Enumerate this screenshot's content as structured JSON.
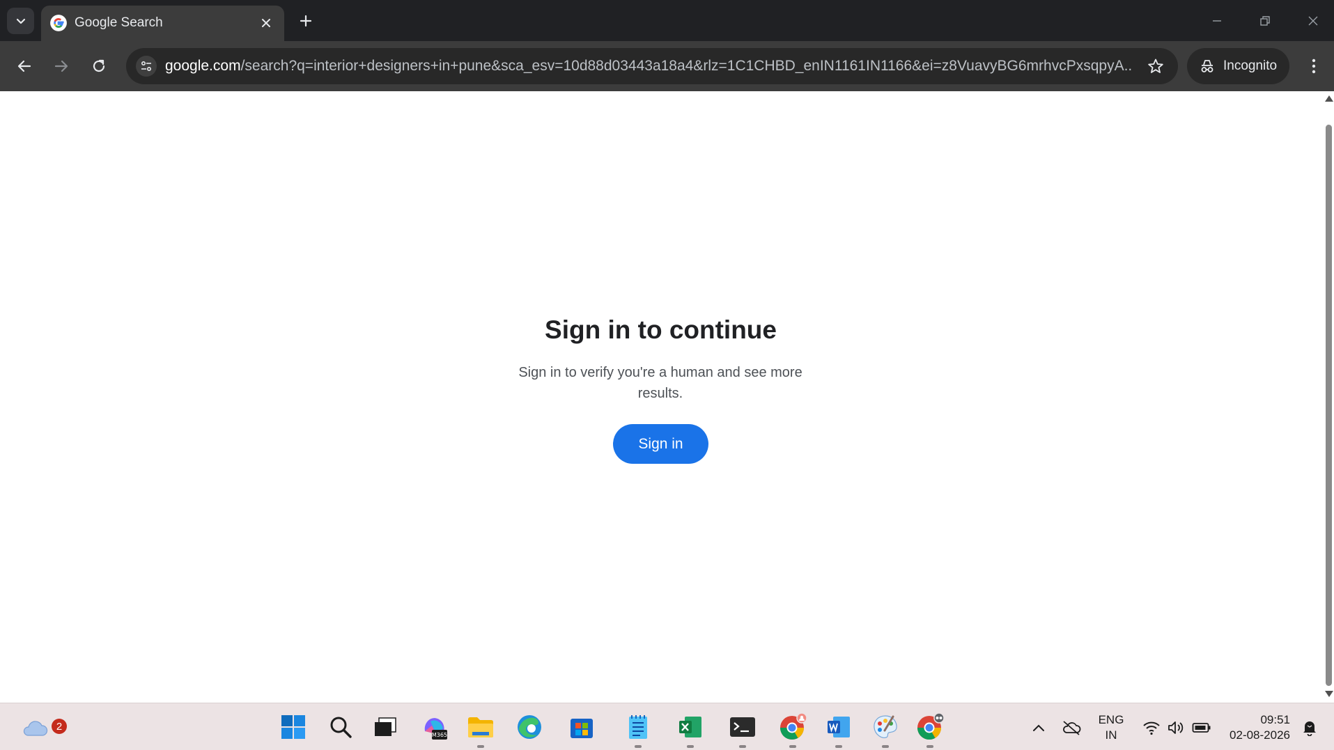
{
  "browser": {
    "tab": {
      "title": "Google Search"
    },
    "address": {
      "host": "google.com",
      "path": "/search?q=interior+designers+in+pune&sca_esv=10d88d03443a18a4&rlz=1C1CHBD_enIN1161IN1166&ei=z8VuavyBG6mrhvcPxsqpyA..."
    },
    "profile": {
      "label": "Incognito"
    }
  },
  "page": {
    "heading": "Sign in to continue",
    "subtext": "Sign in to verify you're a human and see more results.",
    "signin_label": "Sign in",
    "accent_color": "#1a73e8"
  },
  "taskbar": {
    "weather_badge": "2",
    "pinned_apps": [
      "start",
      "search",
      "task-view",
      "microsoft-365",
      "file-explorer",
      "edge",
      "store",
      "notepad",
      "excel",
      "terminal",
      "chrome",
      "word",
      "paint",
      "chrome"
    ],
    "language": {
      "line1": "ENG",
      "line2": "IN"
    },
    "clock": {
      "time": "09:51",
      "date": "02-08-2026"
    }
  }
}
